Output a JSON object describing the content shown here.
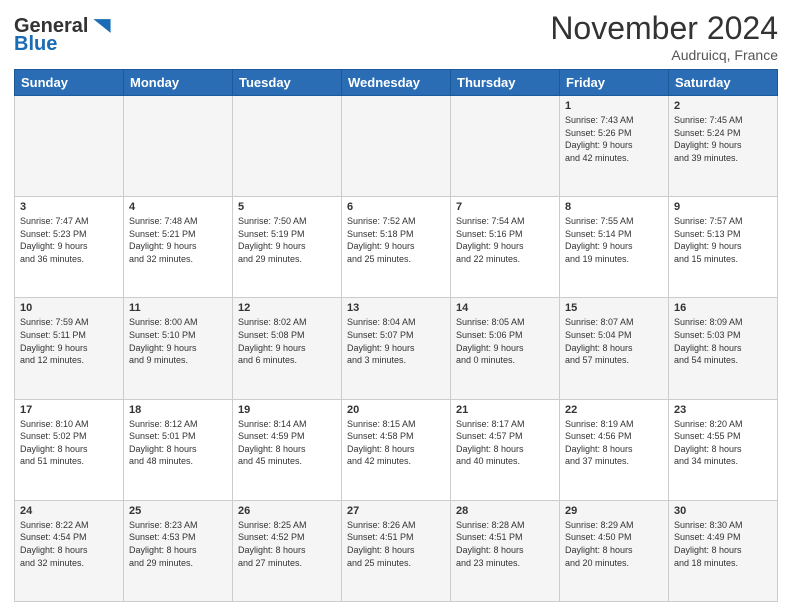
{
  "header": {
    "logo": {
      "general": "General",
      "blue": "Blue"
    },
    "title": "November 2024",
    "location": "Audruicq, France"
  },
  "weekdays": [
    "Sunday",
    "Monday",
    "Tuesday",
    "Wednesday",
    "Thursday",
    "Friday",
    "Saturday"
  ],
  "weeks": [
    {
      "days": [
        {
          "num": "",
          "info": ""
        },
        {
          "num": "",
          "info": ""
        },
        {
          "num": "",
          "info": ""
        },
        {
          "num": "",
          "info": ""
        },
        {
          "num": "",
          "info": ""
        },
        {
          "num": "1",
          "info": "Sunrise: 7:43 AM\nSunset: 5:26 PM\nDaylight: 9 hours\nand 42 minutes."
        },
        {
          "num": "2",
          "info": "Sunrise: 7:45 AM\nSunset: 5:24 PM\nDaylight: 9 hours\nand 39 minutes."
        }
      ]
    },
    {
      "days": [
        {
          "num": "3",
          "info": "Sunrise: 7:47 AM\nSunset: 5:23 PM\nDaylight: 9 hours\nand 36 minutes."
        },
        {
          "num": "4",
          "info": "Sunrise: 7:48 AM\nSunset: 5:21 PM\nDaylight: 9 hours\nand 32 minutes."
        },
        {
          "num": "5",
          "info": "Sunrise: 7:50 AM\nSunset: 5:19 PM\nDaylight: 9 hours\nand 29 minutes."
        },
        {
          "num": "6",
          "info": "Sunrise: 7:52 AM\nSunset: 5:18 PM\nDaylight: 9 hours\nand 25 minutes."
        },
        {
          "num": "7",
          "info": "Sunrise: 7:54 AM\nSunset: 5:16 PM\nDaylight: 9 hours\nand 22 minutes."
        },
        {
          "num": "8",
          "info": "Sunrise: 7:55 AM\nSunset: 5:14 PM\nDaylight: 9 hours\nand 19 minutes."
        },
        {
          "num": "9",
          "info": "Sunrise: 7:57 AM\nSunset: 5:13 PM\nDaylight: 9 hours\nand 15 minutes."
        }
      ]
    },
    {
      "days": [
        {
          "num": "10",
          "info": "Sunrise: 7:59 AM\nSunset: 5:11 PM\nDaylight: 9 hours\nand 12 minutes."
        },
        {
          "num": "11",
          "info": "Sunrise: 8:00 AM\nSunset: 5:10 PM\nDaylight: 9 hours\nand 9 minutes."
        },
        {
          "num": "12",
          "info": "Sunrise: 8:02 AM\nSunset: 5:08 PM\nDaylight: 9 hours\nand 6 minutes."
        },
        {
          "num": "13",
          "info": "Sunrise: 8:04 AM\nSunset: 5:07 PM\nDaylight: 9 hours\nand 3 minutes."
        },
        {
          "num": "14",
          "info": "Sunrise: 8:05 AM\nSunset: 5:06 PM\nDaylight: 9 hours\nand 0 minutes."
        },
        {
          "num": "15",
          "info": "Sunrise: 8:07 AM\nSunset: 5:04 PM\nDaylight: 8 hours\nand 57 minutes."
        },
        {
          "num": "16",
          "info": "Sunrise: 8:09 AM\nSunset: 5:03 PM\nDaylight: 8 hours\nand 54 minutes."
        }
      ]
    },
    {
      "days": [
        {
          "num": "17",
          "info": "Sunrise: 8:10 AM\nSunset: 5:02 PM\nDaylight: 8 hours\nand 51 minutes."
        },
        {
          "num": "18",
          "info": "Sunrise: 8:12 AM\nSunset: 5:01 PM\nDaylight: 8 hours\nand 48 minutes."
        },
        {
          "num": "19",
          "info": "Sunrise: 8:14 AM\nSunset: 4:59 PM\nDaylight: 8 hours\nand 45 minutes."
        },
        {
          "num": "20",
          "info": "Sunrise: 8:15 AM\nSunset: 4:58 PM\nDaylight: 8 hours\nand 42 minutes."
        },
        {
          "num": "21",
          "info": "Sunrise: 8:17 AM\nSunset: 4:57 PM\nDaylight: 8 hours\nand 40 minutes."
        },
        {
          "num": "22",
          "info": "Sunrise: 8:19 AM\nSunset: 4:56 PM\nDaylight: 8 hours\nand 37 minutes."
        },
        {
          "num": "23",
          "info": "Sunrise: 8:20 AM\nSunset: 4:55 PM\nDaylight: 8 hours\nand 34 minutes."
        }
      ]
    },
    {
      "days": [
        {
          "num": "24",
          "info": "Sunrise: 8:22 AM\nSunset: 4:54 PM\nDaylight: 8 hours\nand 32 minutes."
        },
        {
          "num": "25",
          "info": "Sunrise: 8:23 AM\nSunset: 4:53 PM\nDaylight: 8 hours\nand 29 minutes."
        },
        {
          "num": "26",
          "info": "Sunrise: 8:25 AM\nSunset: 4:52 PM\nDaylight: 8 hours\nand 27 minutes."
        },
        {
          "num": "27",
          "info": "Sunrise: 8:26 AM\nSunset: 4:51 PM\nDaylight: 8 hours\nand 25 minutes."
        },
        {
          "num": "28",
          "info": "Sunrise: 8:28 AM\nSunset: 4:51 PM\nDaylight: 8 hours\nand 23 minutes."
        },
        {
          "num": "29",
          "info": "Sunrise: 8:29 AM\nSunset: 4:50 PM\nDaylight: 8 hours\nand 20 minutes."
        },
        {
          "num": "30",
          "info": "Sunrise: 8:30 AM\nSunset: 4:49 PM\nDaylight: 8 hours\nand 18 minutes."
        }
      ]
    }
  ]
}
